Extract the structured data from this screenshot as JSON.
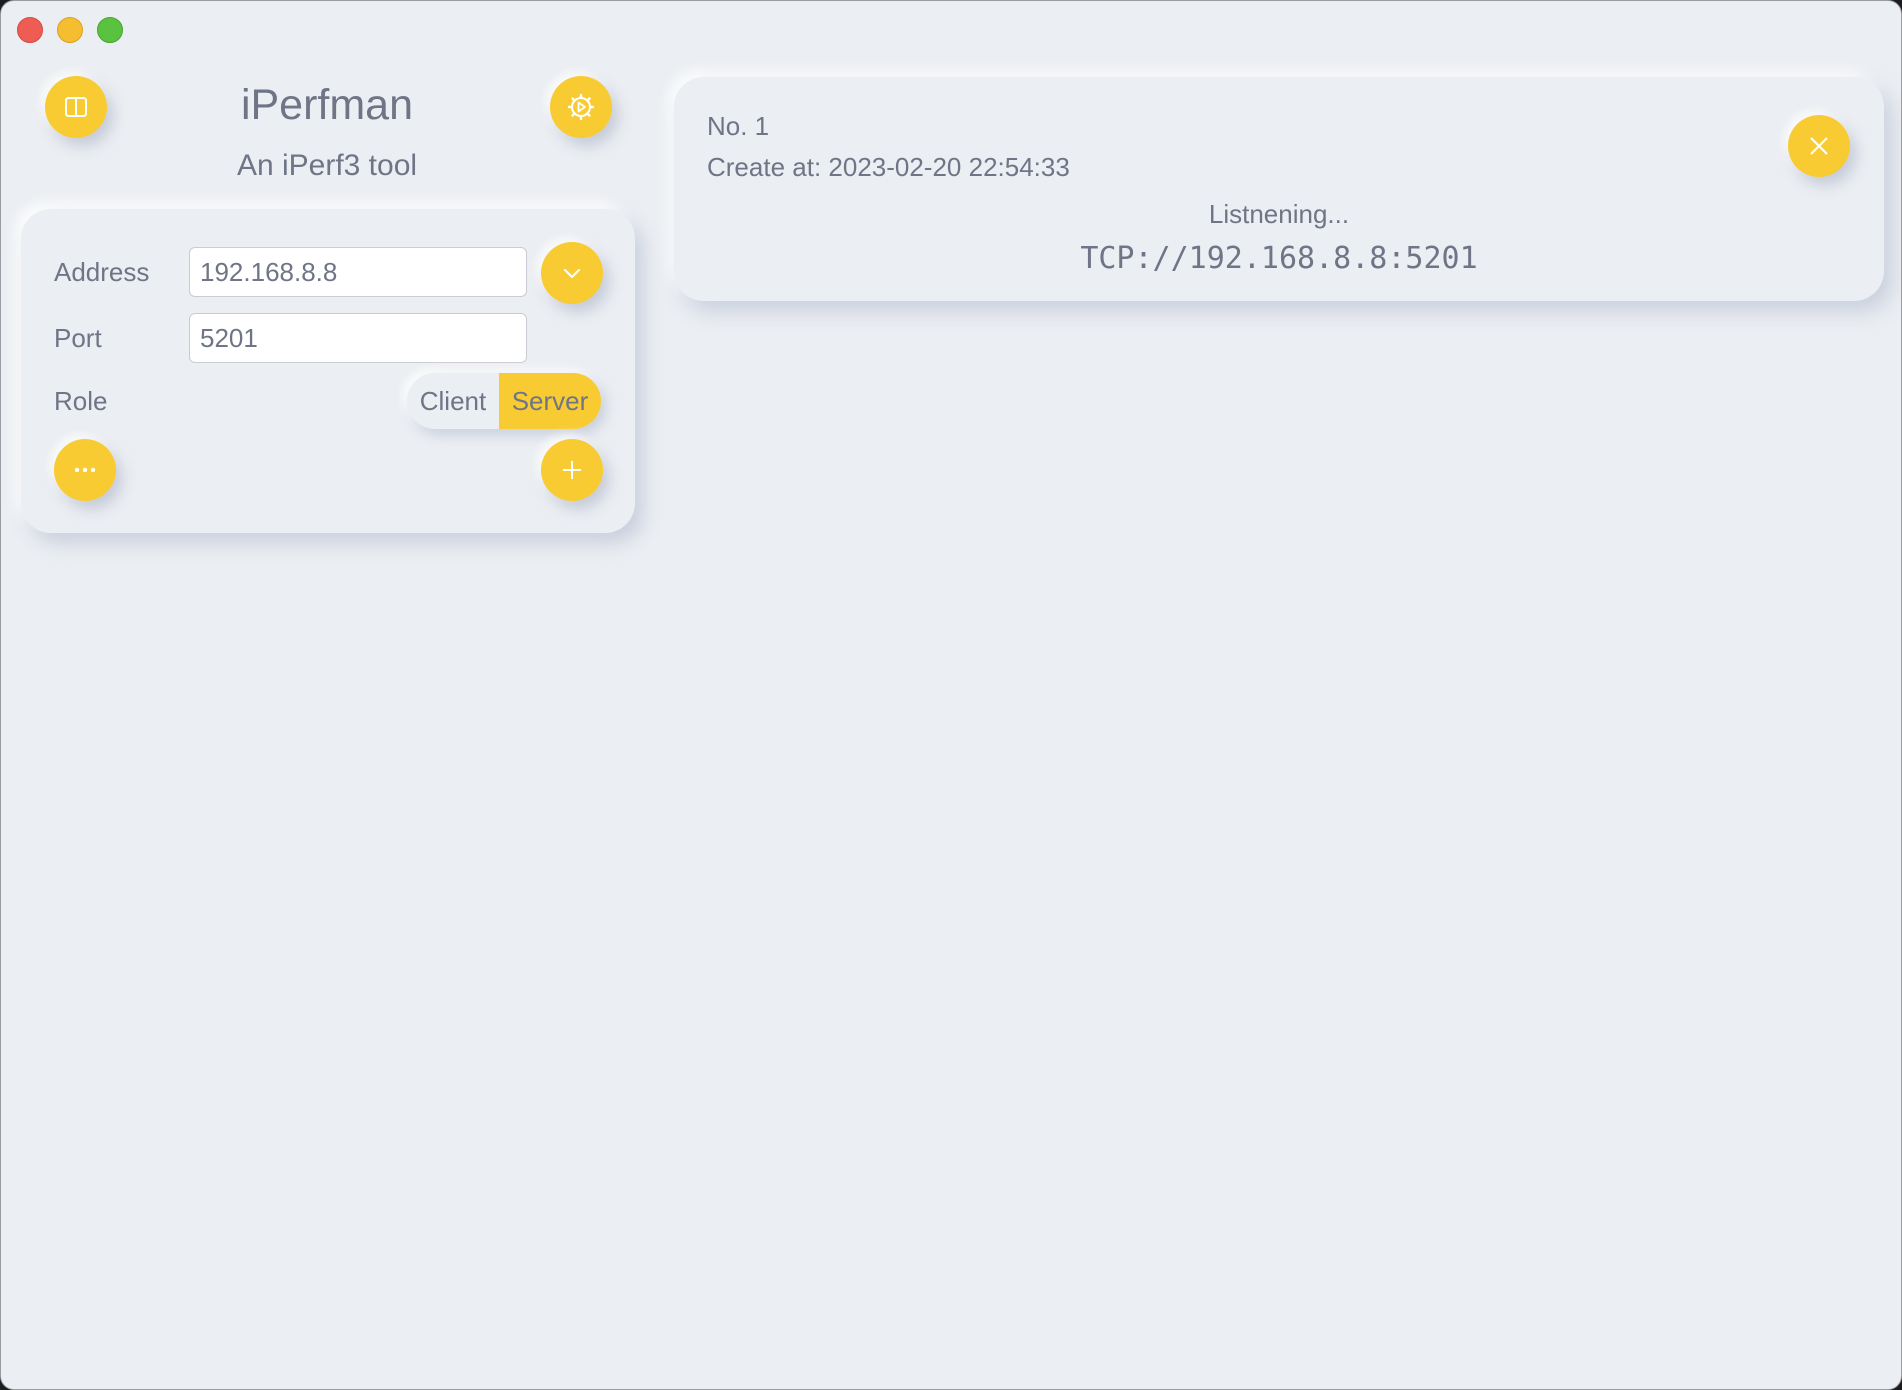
{
  "window": {
    "controls": [
      "close",
      "minimize",
      "maximize"
    ]
  },
  "sidebar": {
    "title": "iPerfman",
    "subtitle": "An iPerf3 tool",
    "toggle_icon": "sidebar-icon",
    "settings_icon": "gear-icon",
    "form": {
      "address_label": "Address",
      "address_value": "192.168.8.8",
      "address_dropdown_icon": "chevron-down-icon",
      "port_label": "Port",
      "port_value": "5201",
      "role_label": "Role",
      "role_options": [
        "Client",
        "Server"
      ],
      "role_selected": "Server",
      "more_icon": "ellipsis-icon",
      "add_icon": "plus-icon"
    }
  },
  "sessions": [
    {
      "number": "No. 1",
      "created": "Create at: 2023-02-20 22:54:33",
      "status": "Listnening...",
      "url": "TCP://192.168.8.8:5201",
      "close_icon": "close-icon"
    }
  ],
  "colors": {
    "accent": "#f8cb32",
    "background": "#ebeef2",
    "text": "#6f7586"
  }
}
